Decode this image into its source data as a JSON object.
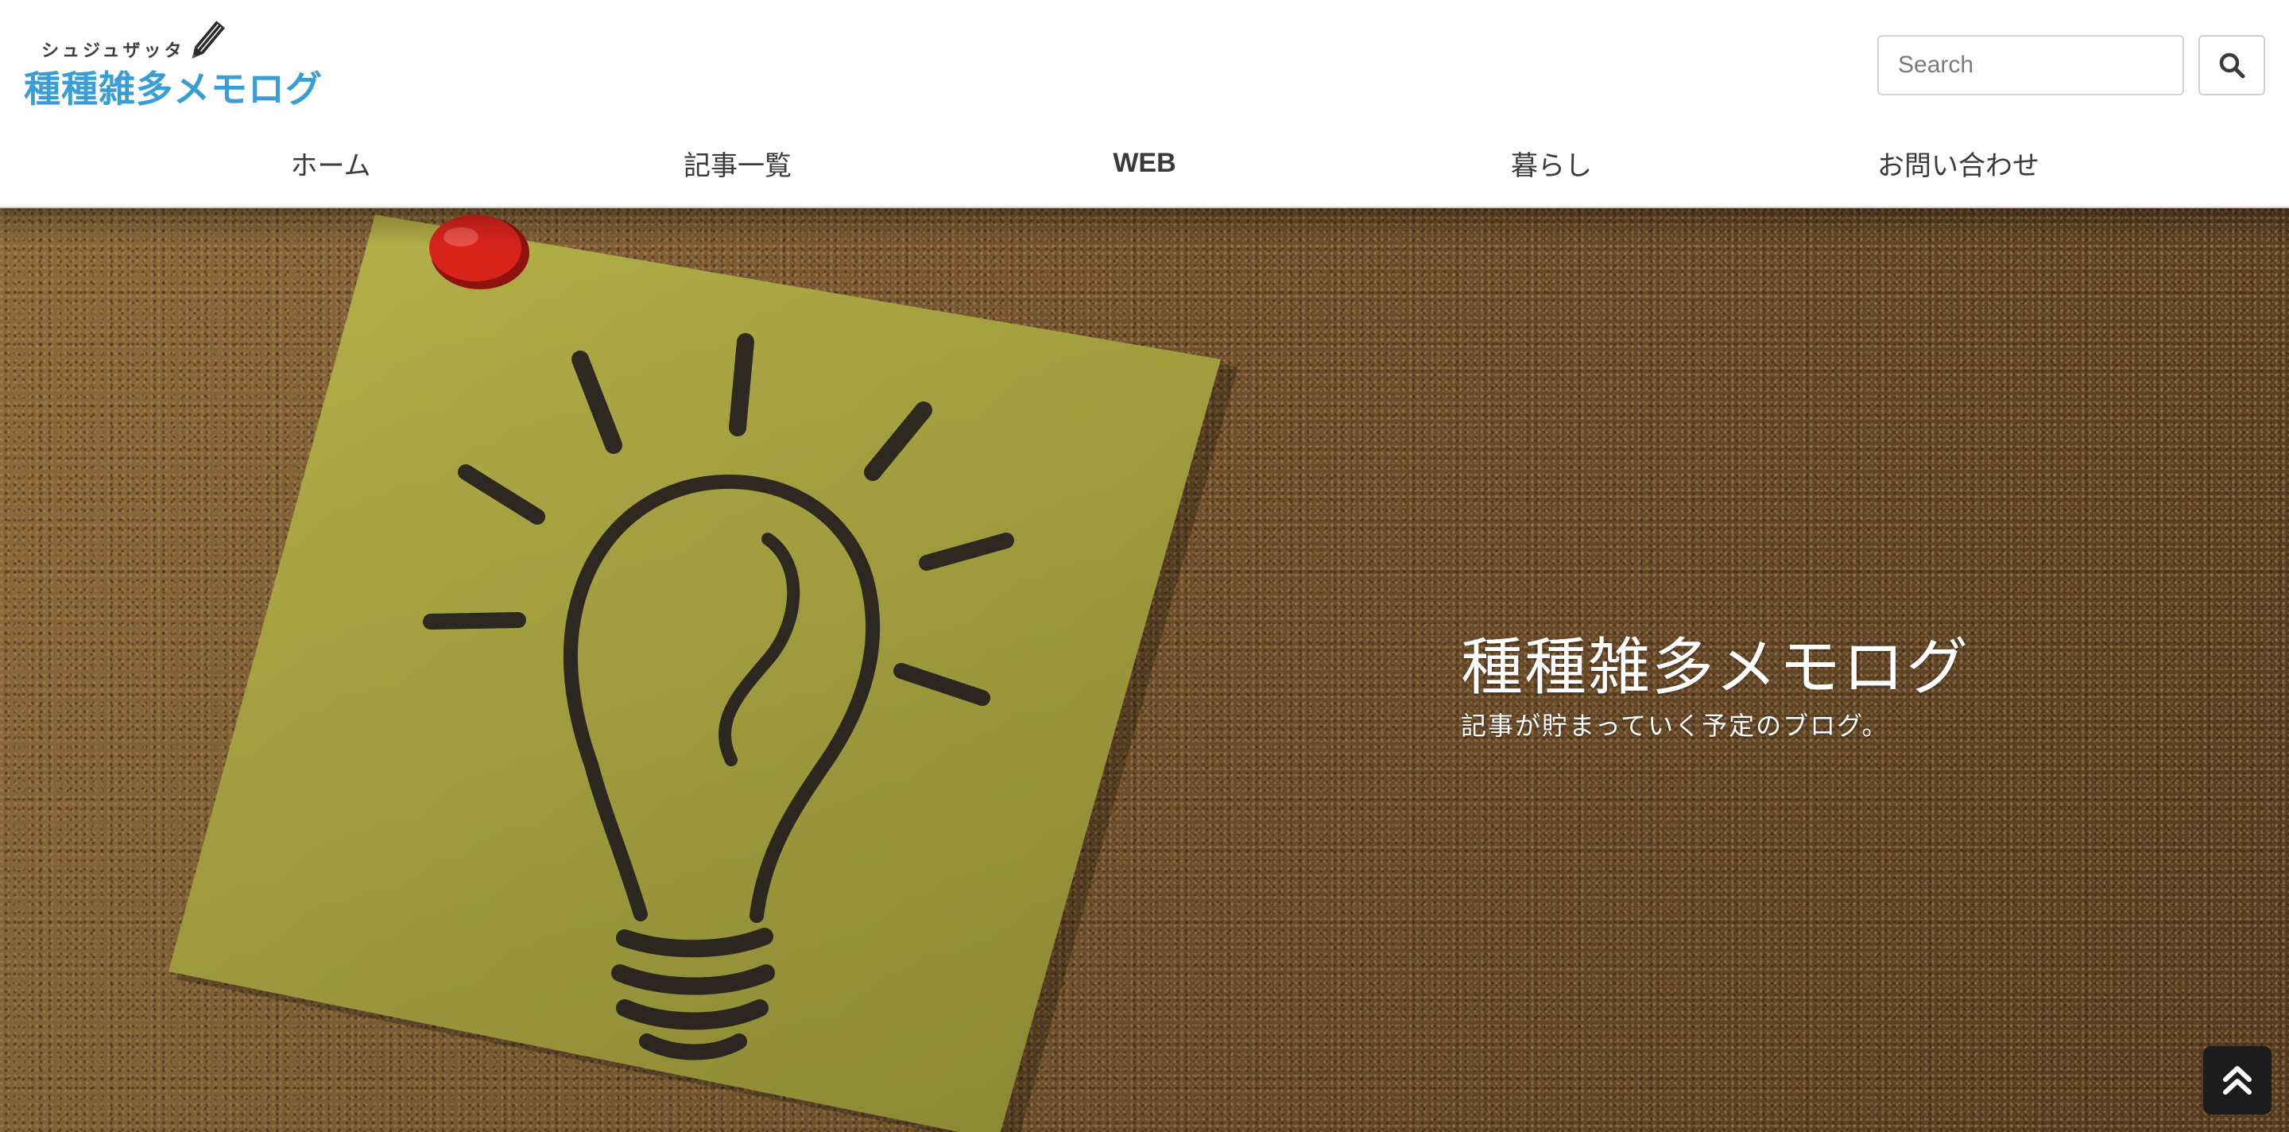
{
  "header": {
    "logo": {
      "ruby": "シュジュザッタ",
      "title": "種種雑多メモログ"
    },
    "search": {
      "placeholder": "Search",
      "value": ""
    },
    "nav": [
      {
        "label": "ホーム"
      },
      {
        "label": "記事一覧"
      },
      {
        "label": "WEB"
      },
      {
        "label": "暮らし"
      },
      {
        "label": "お問い合わせ"
      }
    ]
  },
  "hero": {
    "title": "種種雑多メモログ",
    "subtitle": "記事が貯まっていく予定のブログ。"
  },
  "colors": {
    "brand": "#3a9ed6",
    "nav_text": "#3a3a3a",
    "cork": "#7a5a32",
    "note": "#a9a540",
    "pin": "#d9241b"
  },
  "icons": {
    "logo_pencil": "pencil-icon",
    "search": "search-icon",
    "back_to_top": "double-chevron-up-icon",
    "hero_illustration": "lightbulb-icon"
  }
}
